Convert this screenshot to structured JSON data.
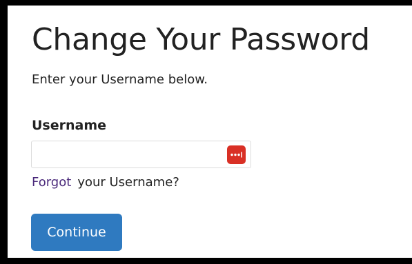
{
  "page": {
    "title": "Change Your Password",
    "instructions": "Enter your Username below."
  },
  "form": {
    "username_label": "Username",
    "username_value": "",
    "username_placeholder": "",
    "password_manager_icon": "password-manager-dots-icon",
    "forgot_link": "Forgot",
    "forgot_suffix": "your Username?",
    "continue_label": "Continue"
  },
  "colors": {
    "accent_button": "#2f7ac0",
    "link": "#4b2a7b",
    "password_manager_icon_bg": "#d93025",
    "text": "#222222",
    "frame_border": "#000000"
  }
}
